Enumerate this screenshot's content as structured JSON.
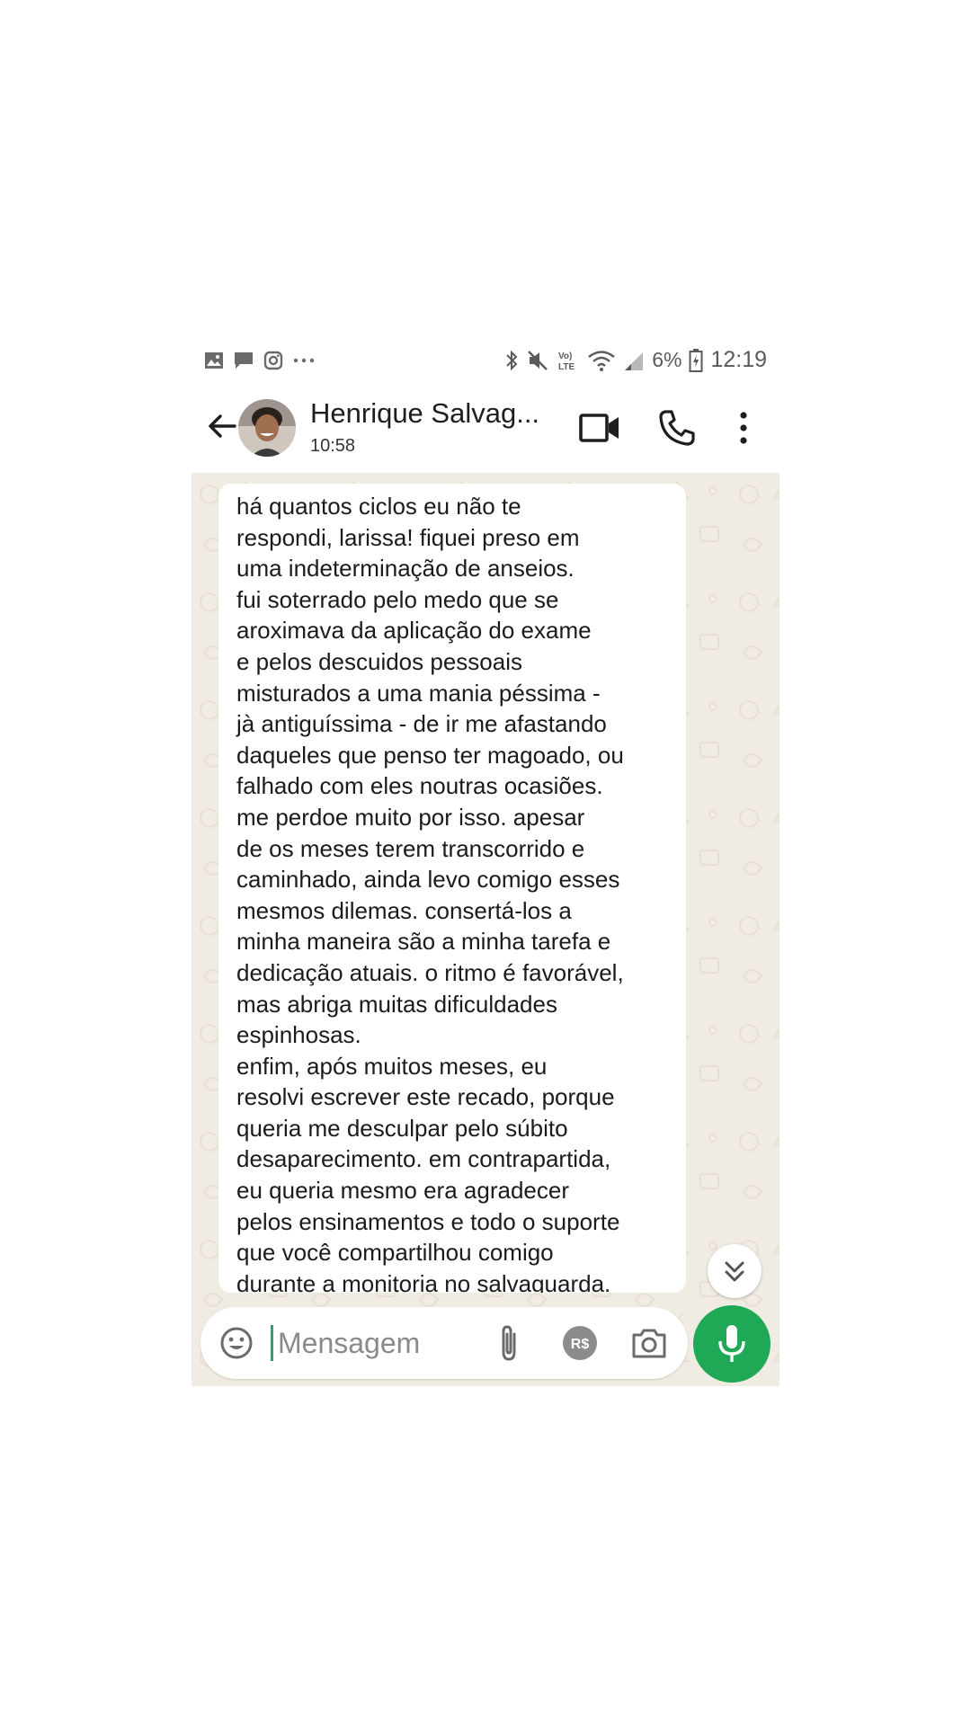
{
  "status_bar": {
    "battery_percent": "6%",
    "time": "12:19",
    "left_icons": [
      "gallery-icon",
      "message-icon",
      "instagram-icon",
      "more-dots-icon"
    ],
    "right_icons": [
      "bluetooth-icon",
      "mute-icon",
      "volte-icon",
      "wifi-icon",
      "signal-icon",
      "battery-icon"
    ]
  },
  "header": {
    "contact_name": "Henrique Salvag...",
    "last_seen": "10:58",
    "icons": [
      "back-arrow-icon",
      "video-call-icon",
      "phone-call-icon",
      "more-vert-icon"
    ]
  },
  "chat": {
    "message_text": "há quantos ciclos eu não te\nrespondi, larissa! fiquei preso em\numa indeterminação de anseios.\nfui soterrado pelo medo que se\naroximava da aplicação do exame\ne pelos descuidos pessoais\nmisturados a uma mania péssima -\njà antiguíssima - de ir me afastando\ndaqueles que penso ter magoado, ou\nfalhado com eles noutras ocasiões.\nme perdoe muito por isso. apesar\nde os meses terem transcorrido e\ncaminhado, ainda levo comigo esses\nmesmos dilemas. consertá-los a\nminha maneira são a minha tarefa e\ndedicação atuais. o ritmo é favorável,\nmas abriga muitas dificuldades\nespinhosas.\nenfim, após muitos meses, eu\nresolvi escrever este recado, porque\nqueria me desculpar pelo súbito\ndesaparecimento. em contrapartida,\neu queria mesmo era agradecer\npelos ensinamentos e todo o suporte\nque você compartilhou comigo\ndurante a monitoria no salvaguarda."
  },
  "composer": {
    "placeholder": "Mensagem",
    "payment_label": "R$",
    "icons": [
      "emoji-icon",
      "attach-icon",
      "payment-icon",
      "camera-icon",
      "mic-icon",
      "scroll-down-icon"
    ]
  },
  "colors": {
    "accent_green": "#1fa855",
    "chat_background": "#f1ece3",
    "bubble": "#ffffff"
  }
}
